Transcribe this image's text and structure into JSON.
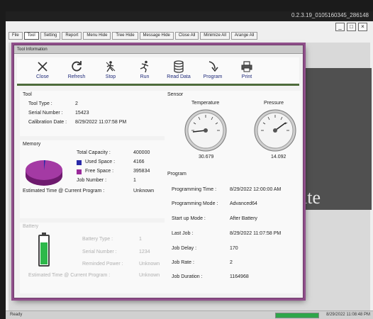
{
  "app": {
    "version": "0.2.3.19_0105160345_286148",
    "window_controls": [
      "_",
      "□",
      "×"
    ],
    "menu": [
      "File",
      "Tool",
      "Setting",
      "Report",
      "Menu Hide",
      "Tree Hide",
      "Message Hide",
      "Close All",
      "Minimize All",
      "Arange All"
    ],
    "active_menu": "Tool",
    "background_text": "ite",
    "status": {
      "ready": "Ready",
      "progress": 1.0,
      "progress_color": "#2fa64a",
      "timestamp": "8/29/2022 11:08:48 PM"
    }
  },
  "dialog": {
    "title": "Tool Information",
    "toolbar": [
      {
        "label": "Close",
        "icon": "close-icon"
      },
      {
        "label": "Refresh",
        "icon": "refresh-icon"
      },
      {
        "label": "Stop",
        "icon": "stop-icon"
      },
      {
        "label": "Run",
        "icon": "run-icon"
      },
      {
        "label": "Read Data",
        "icon": "database-icon"
      },
      {
        "label": "Program",
        "icon": "program-icon"
      },
      {
        "label": "Print",
        "icon": "printer-icon"
      }
    ],
    "tool": {
      "title": "Tool",
      "type_label": "Tool Type :",
      "type_value": "2",
      "serial_label": "Serial Number :",
      "serial_value": "15423",
      "calibration_label": "Calibration Date :",
      "calibration_value": "8/29/2022 11:07:58 PM"
    },
    "memory": {
      "title": "Memory",
      "total_label": "Total Capacity :",
      "total_value": "400000",
      "used_label": "Used Space :",
      "used_value": "4166",
      "free_label": "Free Space :",
      "free_value": "395834",
      "job_label": "Job Number :",
      "job_value": "1",
      "est_label": "Estimated Time @ Current Program :",
      "est_value": "Unknown",
      "used_color": "#2a2aa8",
      "free_color": "#9a2a9a"
    },
    "battery": {
      "title": "Battery",
      "type_label": "Battery Type :",
      "type_value": "1",
      "serial_label": "Serial Number :",
      "serial_value": "1234",
      "power_label": "Reminded Power :",
      "power_value": "Unknown",
      "est_label": "Estimated Time @ Current Program :",
      "est_value": "Unknown",
      "level": 0.8,
      "level_color": "#2db84a"
    },
    "sensor": {
      "title": "Sensor",
      "temperature_label": "Temperature",
      "temperature_value": "30.679",
      "pressure_label": "Pressure",
      "pressure_value": "14.092"
    },
    "program": {
      "title": "Program",
      "rows": [
        {
          "label": "Programming Time :",
          "value": "8/29/2022 12:00:00 AM"
        },
        {
          "label": "Programming Mode :",
          "value": "Advanced64"
        },
        {
          "label": "Start up Mode :",
          "value": "After Battery"
        },
        {
          "label": "Last Job :",
          "value": "8/29/2022 11:07:58 PM"
        },
        {
          "label": "Job Delay :",
          "value": "170"
        },
        {
          "label": "Job Rate :",
          "value": "2"
        },
        {
          "label": "Job Duration :",
          "value": "1164968"
        }
      ]
    }
  }
}
